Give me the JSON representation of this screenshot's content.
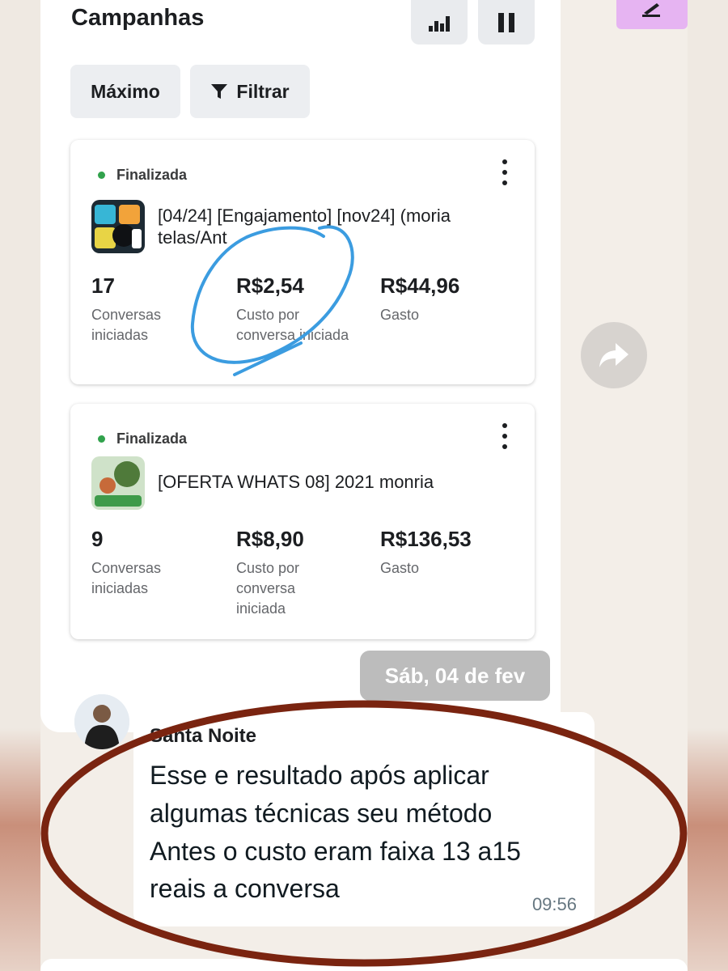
{
  "header": {
    "title": "Campanhas",
    "chart_icon": "bar-chart-icon",
    "pause_icon": "pause-icon"
  },
  "filters": {
    "max_label": "Máximo",
    "filter_label": "Filtrar",
    "filter_icon": "funnel-icon"
  },
  "campaigns": [
    {
      "status": "Finalizada",
      "name_line1": "[04/24] [Engajamento] [nov24] (moria",
      "name_line2": "telas/Ant",
      "metrics": [
        {
          "value": "17",
          "label_line1": "Conversas",
          "label_line2": "iniciadas",
          "label_line3": ""
        },
        {
          "value": "R$2,54",
          "label_line1": "Custo por",
          "label_line2": "conversa iniciada",
          "label_line3": ""
        },
        {
          "value": "R$44,96",
          "label_line1": "Gasto",
          "label_line2": "",
          "label_line3": ""
        }
      ]
    },
    {
      "status": "Finalizada",
      "name_line1": "[OFERTA WHATS 08] 2021 monria",
      "name_line2": "",
      "metrics": [
        {
          "value": "9",
          "label_line1": "Conversas",
          "label_line2": "iniciadas",
          "label_line3": ""
        },
        {
          "value": "R$8,90",
          "label_line1": "Custo por",
          "label_line2": "conversa",
          "label_line3": "iniciada"
        },
        {
          "value": "R$136,53",
          "label_line1": "Gasto",
          "label_line2": "",
          "label_line3": ""
        }
      ]
    }
  ],
  "chat": {
    "date_label": "Sáb, 04 de fev",
    "sender": "Santa Noite",
    "message_lines": [
      "Esse e resultado após aplicar",
      "algumas técnicas seu método",
      "Antes o custo eram faixa 13 a15",
      "reais a conversa"
    ],
    "time": "09:56",
    "share_icon": "forward-arrow-icon"
  },
  "colors": {
    "status_green": "#31a24c",
    "annotation_blue": "#3b9ce0",
    "annotation_brown": "#7a2410"
  }
}
